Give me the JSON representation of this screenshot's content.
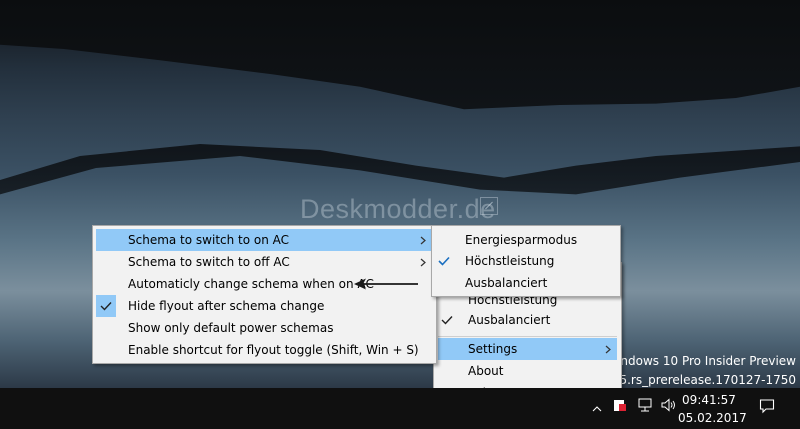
{
  "watermark": "Deskmodder.de",
  "desktop_info": {
    "line1": "Windows 10 Pro Insider Preview",
    "line2": "d 15025.rs_prerelease.170127-1750"
  },
  "clock": {
    "time": "09:41:57",
    "date": "05.02.2017"
  },
  "menu_main": {
    "items": [
      {
        "label": "Schema to switch to on AC",
        "submenu": true,
        "checked": false,
        "highlighted": true
      },
      {
        "label": "Schema to switch to off AC",
        "submenu": true,
        "checked": false,
        "highlighted": false
      },
      {
        "label": "Automaticly change schema when on AC",
        "submenu": false,
        "checked": false,
        "highlighted": false
      },
      {
        "label": "Hide flyout after schema change",
        "submenu": false,
        "checked": true,
        "highlighted": false
      },
      {
        "label": "Show only default power schemas",
        "submenu": false,
        "checked": false,
        "highlighted": false
      },
      {
        "label": "Enable shortcut for flyout toggle (Shift, Win + S)",
        "submenu": false,
        "checked": false,
        "highlighted": false
      }
    ]
  },
  "menu_sub": {
    "items": [
      {
        "label": "Energiesparmodus",
        "checked": false
      },
      {
        "label": "Höchstleistung",
        "checked": true
      },
      {
        "label": "Ausbalanciert",
        "checked": false
      }
    ]
  },
  "menu_tray": {
    "items": [
      {
        "label": "Höchstleistung",
        "checked": false
      },
      {
        "label": "Ausbalanciert",
        "checked": true
      },
      {
        "label": "Settings",
        "submenu": true,
        "highlighted": true
      },
      {
        "label": "About",
        "submenu": false
      },
      {
        "label": "Exit",
        "submenu": false
      }
    ]
  },
  "taskbar_icons": [
    "chevron-up-icon",
    "power-app-icon",
    "network-icon",
    "volume-icon",
    "notification-icon"
  ]
}
